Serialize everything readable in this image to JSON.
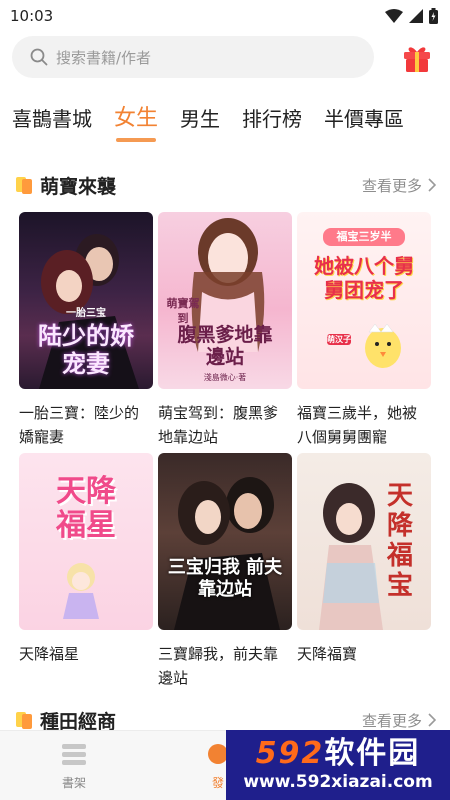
{
  "status_bar": {
    "time": "10:03"
  },
  "search": {
    "placeholder": "搜索書籍/作者"
  },
  "tabs": [
    {
      "label": "喜鵲書城",
      "active": false
    },
    {
      "label": "女生",
      "active": true
    },
    {
      "label": "男生",
      "active": false
    },
    {
      "label": "排行榜",
      "active": false
    },
    {
      "label": "半價專區",
      "active": false
    }
  ],
  "sections": [
    {
      "title": "萌寶來襲",
      "more_label": "查看更多",
      "books": [
        {
          "title": "一胎三寶：陸少的嬌寵妻",
          "cover_text": "陆少的娇宠妻",
          "cover_small": "一胎三宝"
        },
        {
          "title": "萌宝驾到：腹黑爹地靠边站",
          "cover_text": "腹黑爹地靠邊站",
          "cover_small": "萌寶駕到",
          "cover_author": "淺島微心·著"
        },
        {
          "title": "福寶三歲半，她被八個舅舅團寵",
          "cover_text": "她被八个舅舅团宠了",
          "cover_small": "福宝三岁半",
          "cover_badge": "萌汉子"
        }
      ]
    },
    {
      "title": "",
      "more_label": "",
      "books": [
        {
          "title": "天降福星",
          "cover_text": "天降福星"
        },
        {
          "title": "三寶歸我，前夫靠邊站",
          "cover_text": "三宝归我 前夫靠边站"
        },
        {
          "title": "天降福寶",
          "cover_text": "天降福宝"
        }
      ]
    },
    {
      "title": "種田經商",
      "more_label": "查看更多",
      "books": []
    }
  ],
  "bottom_nav": [
    {
      "label": "書架"
    },
    {
      "label": "發"
    }
  ],
  "watermark": {
    "big_num": "592",
    "big_text": "软件园",
    "url": "www.592xiazai.com"
  },
  "colors": {
    "accent": "#f28232",
    "section_mark_a": "#ffd24a",
    "section_mark_b": "#ff9a3c",
    "watermark_bg": "#1f1f8c"
  }
}
